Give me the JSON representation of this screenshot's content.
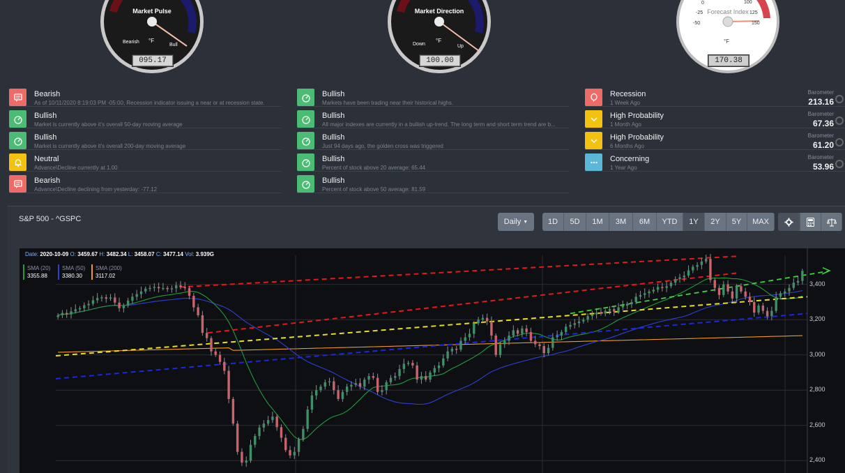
{
  "gauges": {
    "pulse": {
      "title": "Market Pulse",
      "left_label": "Bearish",
      "right_label": "Bull",
      "unit": "°F",
      "readout": "095.17"
    },
    "direction": {
      "title": "Market Direction",
      "left_label": "Down",
      "right_label": "Up",
      "unit": "°F",
      "readout": "100.00"
    },
    "forecast": {
      "title": "Forecast Index",
      "ticks": [
        "0",
        "100",
        "-25",
        "125",
        "-50",
        "150"
      ],
      "unit": "°F",
      "readout": "170.38"
    }
  },
  "signals_left": [
    {
      "status": "Bearish",
      "detail": "As of 10/11/2020 8:19:03 PM -05:00, Recession indicator issuing a near or at recession state.",
      "icon": "chat-icon",
      "color": "#ef6b68"
    },
    {
      "status": "Bullish",
      "detail": "Market is currently above it's overall 50-day moving average",
      "icon": "speedometer-icon",
      "color": "#4cbb73"
    },
    {
      "status": "Bullish",
      "detail": "Market is currently above it's overall 200-day moving average",
      "icon": "speedometer-icon",
      "color": "#4cbb73"
    },
    {
      "status": "Neutral",
      "detail": "Advance\\Decline currently at 1.00",
      "icon": "bell-icon",
      "color": "#f3c10f"
    },
    {
      "status": "Bearish",
      "detail": "Advance\\Decline declining from yesterday: -77.12",
      "icon": "chat-icon",
      "color": "#ef6b68"
    }
  ],
  "signals_mid": [
    {
      "status": "Bullish",
      "detail": "Markets have been trading near their historical highs.",
      "icon": "speedometer-icon",
      "color": "#4cbb73"
    },
    {
      "status": "Bullish",
      "detail": "All major indexes are currently in a bullish up-trend. The long term and short term trend are b...",
      "icon": "speedometer-icon",
      "color": "#4cbb73"
    },
    {
      "status": "Bullish",
      "detail": "Just 94 days ago, the golden cross was triggered",
      "icon": "speedometer-icon",
      "color": "#4cbb73"
    },
    {
      "status": "Bullish",
      "detail": "Percent of stock above 20 average: 65.44",
      "icon": "speedometer-icon",
      "color": "#4cbb73"
    },
    {
      "status": "Bullish",
      "detail": "Percent of stock above 50 average: 81.59",
      "icon": "speedometer-icon",
      "color": "#4cbb73"
    }
  ],
  "barometers": [
    {
      "status": "Recession",
      "when": "1 Week Ago",
      "label": "Barometer",
      "value": "213.16",
      "icon": "balloon-icon",
      "color": "#ef6b68"
    },
    {
      "status": "High Probability",
      "when": "1 Month Ago",
      "label": "Barometer",
      "value": "67.36",
      "icon": "chevron-down-icon",
      "color": "#f3c10f"
    },
    {
      "status": "High Probability",
      "when": "6 Months Ago",
      "label": "Barometer",
      "value": "61.20",
      "icon": "chevron-down-icon",
      "color": "#f3c10f"
    },
    {
      "status": "Concerning",
      "when": "1 Year Ago",
      "label": "Barometer",
      "value": "53.96",
      "icon": "ellipsis-icon",
      "color": "#5ab7d8"
    }
  ],
  "chart_panel": {
    "title": "S&P 500 - ^GSPC",
    "interval": "Daily",
    "ranges": [
      "1D",
      "5D",
      "1M",
      "3M",
      "6M",
      "YTD",
      "1Y",
      "2Y",
      "5Y",
      "MAX"
    ],
    "selected_range": "1Y",
    "tools": [
      "settings-icon",
      "calculator-icon",
      "balance-scale-icon"
    ]
  },
  "chart_data": {
    "type": "candlestick",
    "info": {
      "date_label": "Date:",
      "date": "2020-10-09",
      "o_label": "O:",
      "o": "3459.67",
      "h_label": "H:",
      "h": "3482.34",
      "l_label": "L:",
      "l": "3458.07",
      "c_label": "C:",
      "c": "3477.14",
      "vol_label": "Vol:",
      "vol": "3.939G"
    },
    "legend": [
      {
        "name": "SMA (20)",
        "value": "3355.88",
        "color": "#1f9e3a"
      },
      {
        "name": "SMA (50)",
        "value": "3380.30",
        "color": "#2f3fd8"
      },
      {
        "name": "SMA (200)",
        "value": "3117.02",
        "color": "#f29a1d"
      }
    ],
    "y_ticks": [
      2400,
      2600,
      2800,
      3000,
      3200,
      3400
    ],
    "y_tick_labels": [
      "2,400",
      "2,600",
      "2,800",
      "3,000",
      "3,200",
      "3,400"
    ],
    "ylim": [
      2330,
      3565
    ],
    "closes": [
      3225,
      3238,
      3230,
      3247,
      3259,
      3265,
      3282,
      3290,
      3310,
      3323,
      3327,
      3319,
      3326,
      3297,
      3265,
      3280,
      3308,
      3330,
      3345,
      3360,
      3376,
      3380,
      3386,
      3378,
      3380,
      3373,
      3378,
      3395,
      3385,
      3380,
      3335,
      3270,
      3225,
      3125,
      3095,
      3020,
      3000,
      2960,
      2910,
      2750,
      2610,
      2450,
      2389,
      2400,
      2490,
      2540,
      2588,
      2610,
      2630,
      2650,
      2590,
      2530,
      2460,
      2430,
      2450,
      2520,
      2580,
      2690,
      2770,
      2800,
      2820,
      2845,
      2850,
      2800,
      2750,
      2790,
      2820,
      2830,
      2840,
      2820,
      2860,
      2880,
      2870,
      2790,
      2800,
      2845,
      2870,
      2880,
      2920,
      2950,
      2955,
      2940,
      2860,
      2880,
      2860,
      2900,
      2925,
      2940,
      2980,
      3020,
      3035,
      3030,
      3080,
      3100,
      3120,
      3180,
      3200,
      3210,
      3190,
      3110,
      3000,
      3060,
      3080,
      3110,
      3140,
      3120,
      3150,
      3130,
      3080,
      3060,
      3050,
      3010,
      3040,
      3100,
      3110,
      3130,
      3160,
      3170,
      3180,
      3190,
      3200,
      3220,
      3230,
      3240,
      3235,
      3250,
      3260,
      3245,
      3270,
      3280,
      3290,
      3300,
      3330,
      3340,
      3350,
      3360,
      3370,
      3385,
      3380,
      3390,
      3410,
      3430,
      3440,
      3450,
      3480,
      3500,
      3510,
      3530,
      3545,
      3425,
      3380,
      3340,
      3400,
      3360,
      3320,
      3390,
      3360,
      3330,
      3300,
      3240,
      3280,
      3250,
      3220,
      3250,
      3330,
      3350,
      3360,
      3380,
      3410,
      3420,
      3477
    ]
  }
}
